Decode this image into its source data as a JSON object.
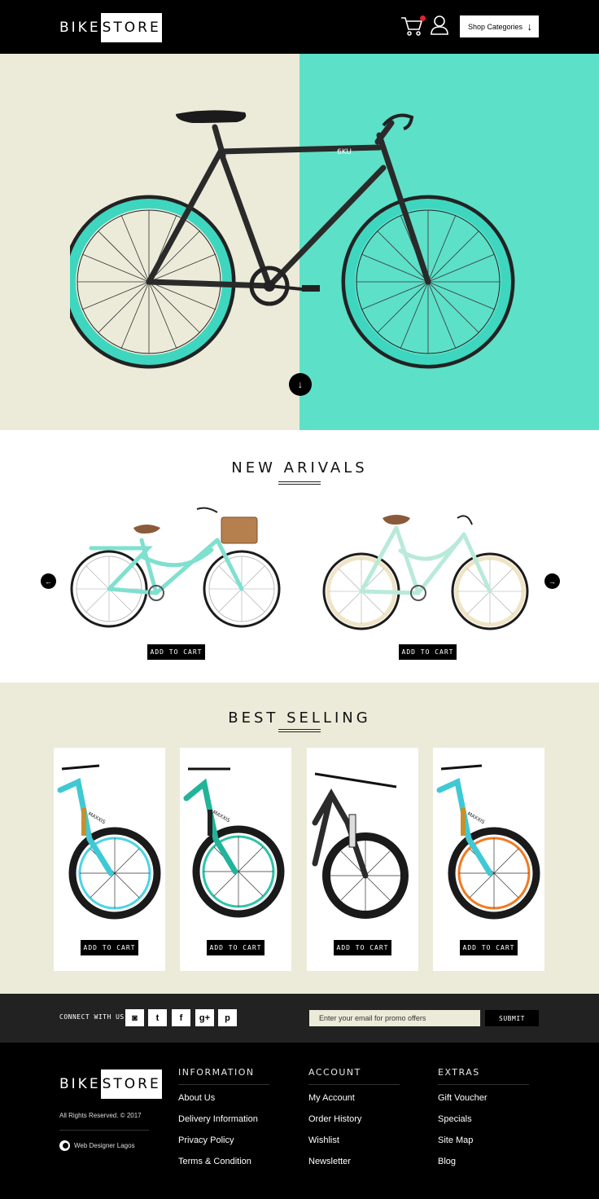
{
  "header": {
    "logo_left": "BIKE",
    "logo_right": "STORE",
    "shop_categories_label": "Shop Categories",
    "shop_categories_arrow": "↓"
  },
  "hero": {
    "scroll_arrow": "↓",
    "frame_brand": "6KU",
    "colors": {
      "left": "#ecebd9",
      "right": "#5de0c8"
    }
  },
  "new_arrivals": {
    "title": "NEW ARIVALS",
    "prev_arrow": "←",
    "next_arrow": "→",
    "items": [
      {
        "button_label": "ADD TO CART"
      },
      {
        "button_label": "ADD TO CART"
      }
    ]
  },
  "best_selling": {
    "title": "BEST SELLING",
    "tire_brand": "MAXXIS",
    "items": [
      {
        "button_label": "ADD TO CART"
      },
      {
        "button_label": "ADD TO CART"
      },
      {
        "button_label": "ADD TO CART"
      },
      {
        "button_label": "ADD TO CART"
      }
    ]
  },
  "connect": {
    "label": "CONNECT WITH US:",
    "social": [
      {
        "icon": "instagram-icon",
        "glyph": "◙"
      },
      {
        "icon": "twitter-icon",
        "glyph": "t"
      },
      {
        "icon": "facebook-icon",
        "glyph": "f"
      },
      {
        "icon": "google-plus-icon",
        "glyph": "g+"
      },
      {
        "icon": "pinterest-icon",
        "glyph": "p"
      }
    ],
    "email_placeholder": "Enter your email for promo offers",
    "submit_label": "SUBMIT"
  },
  "footer": {
    "logo_left": "BIKE",
    "logo_right": "STORE",
    "rights": "All Rights Reserved. © 2017",
    "designer": "Web Designer Lagos",
    "columns": [
      {
        "heading": "INFORMATION",
        "items": [
          "About Us",
          "Delivery Information",
          "Privacy Policy",
          "Terms & Condition"
        ]
      },
      {
        "heading": "ACCOUNT",
        "items": [
          "My Account",
          "Order History",
          "Wishlist",
          "Newsletter"
        ]
      },
      {
        "heading": "EXTRAS",
        "items": [
          "Gift Voucher",
          "Specials",
          "Site Map",
          "Blog"
        ]
      }
    ]
  }
}
